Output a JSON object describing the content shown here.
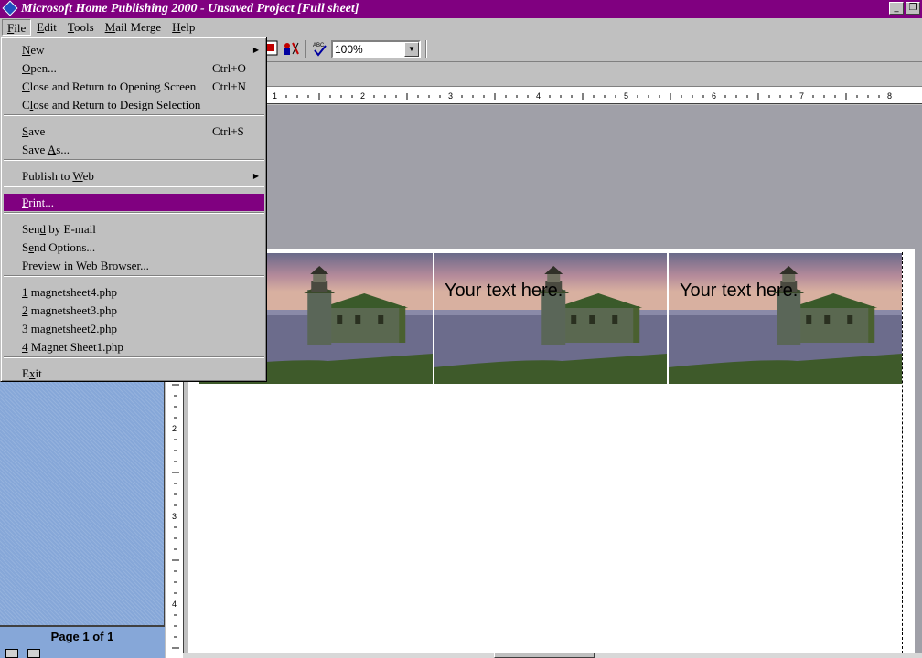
{
  "window": {
    "title": "Microsoft Home Publishing 2000 - Unsaved Project [Full sheet]"
  },
  "menubar": [
    "File",
    "Edit",
    "Tools",
    "Mail Merge",
    "Help"
  ],
  "menubar_underline": [
    "F",
    "E",
    "T",
    "M",
    "H"
  ],
  "toolbar": {
    "zoom": "100%",
    "icons": [
      "picture-icon",
      "spelling-icon"
    ]
  },
  "ruler": {
    "h_ticks": [
      "1",
      "2",
      "3",
      "4",
      "5",
      "6",
      "7",
      "8"
    ],
    "v_ticks": [
      "2",
      "3",
      "4"
    ]
  },
  "file_menu": {
    "groups": [
      [
        {
          "label": "New",
          "u": "N",
          "submenu": true
        },
        {
          "label": "Open...",
          "u": "O",
          "shortcut": "Ctrl+O"
        },
        {
          "label": "Close and Return to Opening Screen",
          "u": "C",
          "shortcut": "Ctrl+N"
        },
        {
          "label": "Close and Return to Design Selection",
          "u": "l"
        }
      ],
      [
        {
          "label": "Save",
          "u": "S",
          "shortcut": "Ctrl+S"
        },
        {
          "label": "Save As...",
          "u": "A"
        }
      ],
      [
        {
          "label": "Publish to Web",
          "u": "W",
          "submenu": true
        }
      ],
      [
        {
          "label": "Print...",
          "u": "P",
          "highlighted": true
        }
      ],
      [
        {
          "label": "Send by E-mail",
          "u": "d"
        },
        {
          "label": "Send Options...",
          "u": "e"
        },
        {
          "label": "Preview in Web Browser...",
          "u": "v"
        }
      ],
      [
        {
          "label": "1 magnetsheet4.php",
          "u": "1"
        },
        {
          "label": "2 magnetsheet3.php",
          "u": "2"
        },
        {
          "label": "3 magnetsheet2.php",
          "u": "3"
        },
        {
          "label": "4 Magnet Sheet1.php",
          "u": "4"
        }
      ],
      [
        {
          "label": "Exit",
          "u": "x"
        }
      ]
    ]
  },
  "magnets": [
    {
      "text": "ext here."
    },
    {
      "text": "Your text here."
    },
    {
      "text": "Your text here."
    }
  ],
  "pane": {
    "page_label": "Page 1 of 1"
  },
  "colors": {
    "titlebar": "#800080",
    "highlight": "#800080",
    "pane": "#86a7d8",
    "workspace": "#a0a0a8"
  }
}
